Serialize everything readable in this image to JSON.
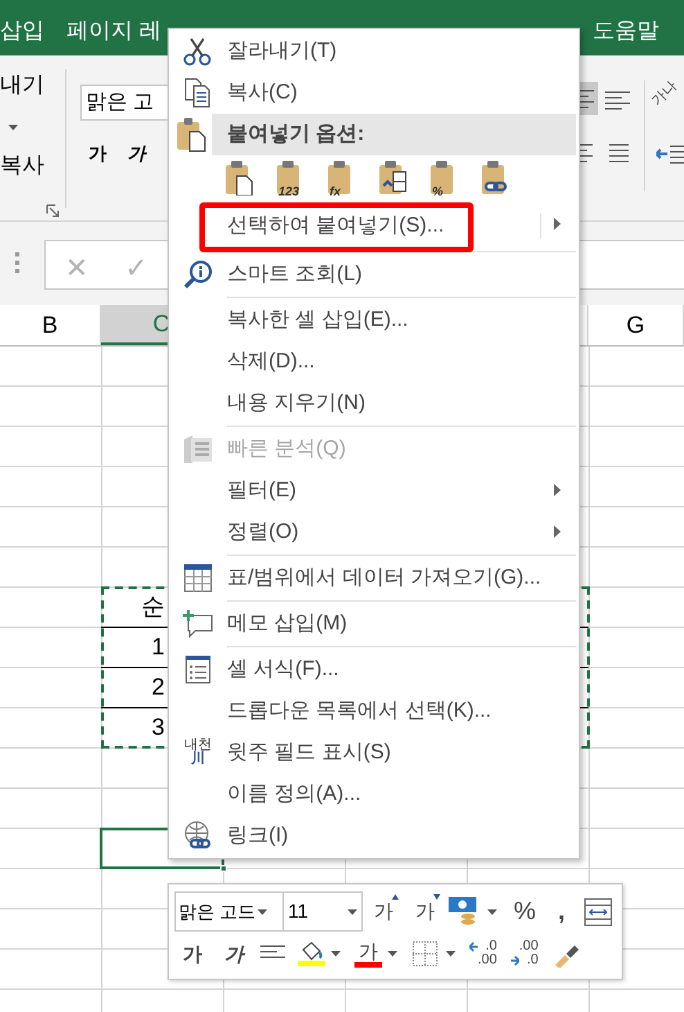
{
  "title_bar": {
    "tabs": [
      "삽입",
      "페이지 레",
      "도움말"
    ]
  },
  "ribbon": {
    "cut_label": "내기",
    "copy_label": "복사",
    "font_name": "맑은 고",
    "bold_label": "가",
    "italic_label": "가",
    "orientation_label": "가나"
  },
  "formula_bar": {
    "cancel": "✕",
    "enter": "✓"
  },
  "columns": [
    {
      "label": "B",
      "selected": false
    },
    {
      "label": "C",
      "selected": true
    },
    {
      "label": "G",
      "selected": false
    }
  ],
  "cells": [
    {
      "text": "순"
    },
    {
      "text": "1"
    },
    {
      "text": "2"
    },
    {
      "text": "3"
    }
  ],
  "menu": {
    "items": [
      {
        "kind": "item",
        "label": "잘라내기(T)",
        "disabled": false,
        "submenu": false,
        "highlighted": false
      },
      {
        "kind": "item",
        "label": "복사(C)",
        "disabled": false,
        "submenu": false,
        "highlighted": false
      },
      {
        "kind": "header",
        "label": "붙여넣기 옵션:"
      },
      {
        "kind": "paste_options",
        "buttons": [
          {
            "kind": "paste"
          },
          {
            "kind": "values",
            "label": "123"
          },
          {
            "kind": "formulas",
            "label": "fx"
          },
          {
            "kind": "transpose"
          },
          {
            "kind": "formatting",
            "label": "%"
          },
          {
            "kind": "link"
          }
        ]
      },
      {
        "kind": "item",
        "label": "선택하여 붙여넣기(S)...",
        "disabled": false,
        "submenu": true,
        "highlighted": true
      },
      {
        "kind": "separator"
      },
      {
        "kind": "item",
        "label": "스마트 조회(L)",
        "disabled": false,
        "submenu": false,
        "highlighted": false
      },
      {
        "kind": "separator"
      },
      {
        "kind": "item",
        "label": "복사한 셀 삽입(E)...",
        "disabled": false,
        "submenu": false,
        "highlighted": false
      },
      {
        "kind": "item",
        "label": "삭제(D)...",
        "disabled": false,
        "submenu": false,
        "highlighted": false
      },
      {
        "kind": "item",
        "label": "내용 지우기(N)",
        "disabled": false,
        "submenu": false,
        "highlighted": false
      },
      {
        "kind": "separator"
      },
      {
        "kind": "item",
        "label": "빠른 분석(Q)",
        "disabled": true,
        "submenu": false,
        "highlighted": false
      },
      {
        "kind": "item",
        "label": "필터(E)",
        "disabled": false,
        "submenu": true,
        "highlighted": false
      },
      {
        "kind": "item",
        "label": "정렬(O)",
        "disabled": false,
        "submenu": true,
        "highlighted": false
      },
      {
        "kind": "separator"
      },
      {
        "kind": "item",
        "label": "표/범위에서 데이터 가져오기(G)...",
        "disabled": false,
        "submenu": false,
        "highlighted": false
      },
      {
        "kind": "separator"
      },
      {
        "kind": "item",
        "label": "메모 삽입(M)",
        "disabled": false,
        "submenu": false,
        "highlighted": false
      },
      {
        "kind": "separator"
      },
      {
        "kind": "item",
        "label": "셀 서식(F)...",
        "disabled": false,
        "submenu": false,
        "highlighted": false
      },
      {
        "kind": "item",
        "label": "드롭다운 목록에서 선택(K)...",
        "disabled": false,
        "submenu": false,
        "highlighted": false
      },
      {
        "kind": "item",
        "label": "윗주 필드 표시(S)",
        "icon_text": [
          "내천",
          "川"
        ],
        "disabled": false,
        "submenu": false,
        "highlighted": false
      },
      {
        "kind": "item",
        "label": "이름 정의(A)...",
        "disabled": false,
        "submenu": false,
        "highlighted": false
      },
      {
        "kind": "item",
        "label": "링크(I)",
        "disabled": false,
        "submenu": false,
        "highlighted": false
      }
    ]
  },
  "mini_toolbar": {
    "font_name": "맑은 고드",
    "font_size": "11",
    "row1": [
      {
        "kind": "grow",
        "label": "가"
      },
      {
        "kind": "shrink",
        "label": "가"
      },
      {
        "kind": "accounting"
      },
      {
        "kind": "percent",
        "label": "%"
      },
      {
        "kind": "comma",
        "label": ","
      },
      {
        "kind": "wrap"
      }
    ],
    "row2": [
      {
        "kind": "bold",
        "label": "가"
      },
      {
        "kind": "italic",
        "label": "가"
      },
      {
        "kind": "center"
      },
      {
        "kind": "fill",
        "color": "#ffff00"
      },
      {
        "kind": "font_color",
        "label": "가",
        "color": "#ff0000"
      },
      {
        "kind": "borders"
      },
      {
        "kind": "inc_decimal",
        "lines": [
          ".0",
          ".00"
        ]
      },
      {
        "kind": "dec_decimal",
        "lines": [
          ".00",
          ".0"
        ]
      },
      {
        "kind": "painter"
      }
    ]
  }
}
